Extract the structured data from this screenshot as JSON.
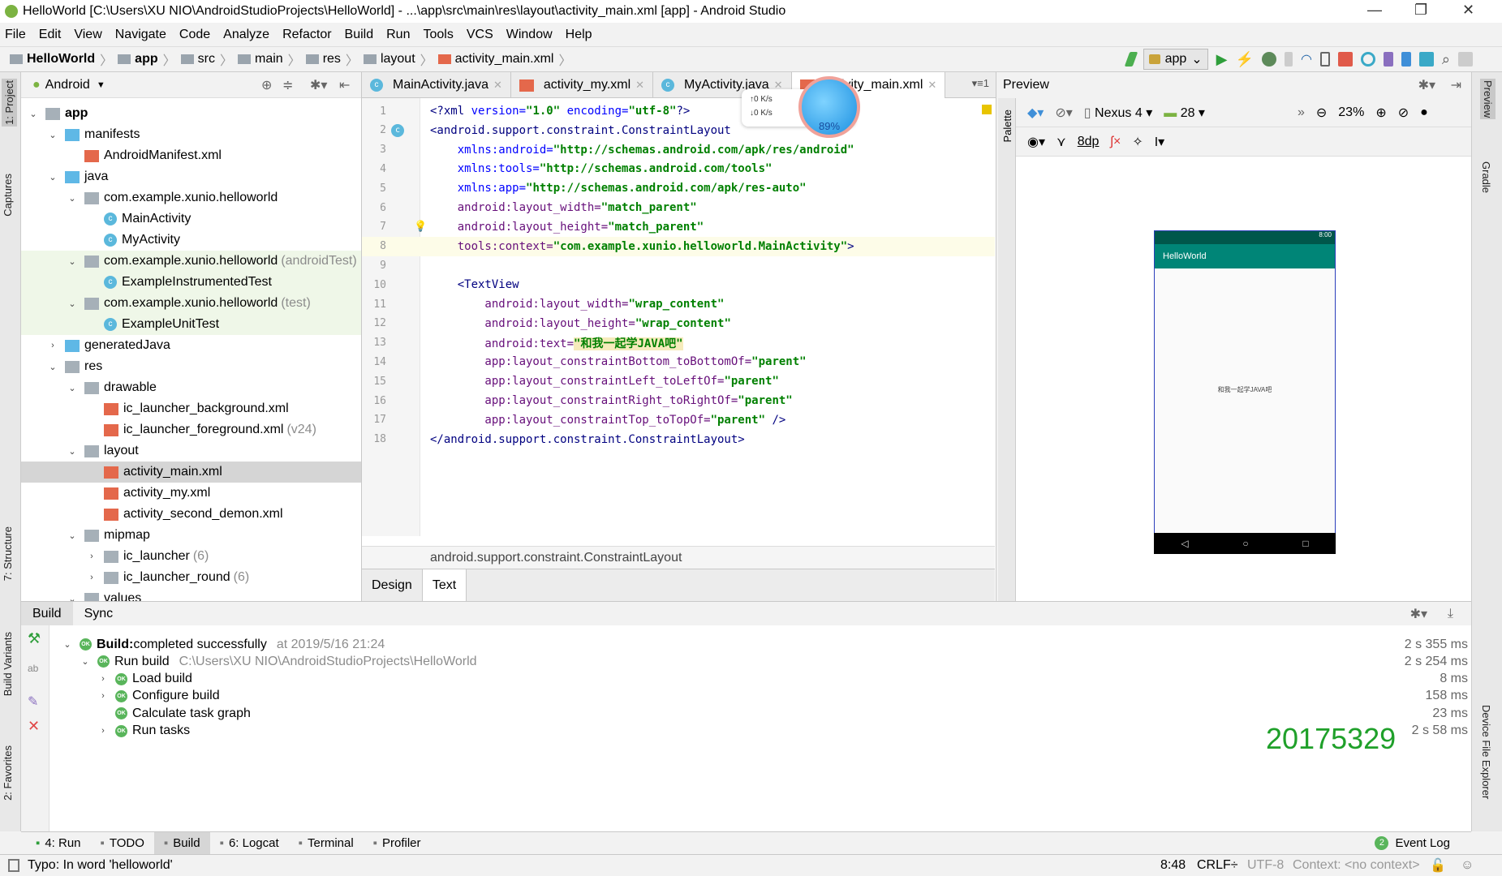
{
  "window": {
    "title": "HelloWorld [C:\\Users\\XU NIO\\AndroidStudioProjects\\HelloWorld] - ...\\app\\src\\main\\res\\layout\\activity_main.xml [app] - Android Studio",
    "minimize": "—",
    "maximize": "❐",
    "close": "✕"
  },
  "menu": [
    "File",
    "Edit",
    "View",
    "Navigate",
    "Code",
    "Analyze",
    "Refactor",
    "Build",
    "Run",
    "Tools",
    "VCS",
    "Window",
    "Help"
  ],
  "breadcrumb": [
    "HelloWorld",
    "app",
    "src",
    "main",
    "res",
    "layout",
    "activity_main.xml"
  ],
  "toolbar": {
    "run_config": "app"
  },
  "left_strip": {
    "project": "1: Project",
    "captures": "Captures",
    "structure": "7: Structure",
    "build_variants": "Build Variants",
    "favorites": "2: Favorites"
  },
  "project": {
    "view": "Android",
    "tree": [
      {
        "label": "app",
        "depth": 0,
        "arrow": "v",
        "icon": "folder",
        "bold": true
      },
      {
        "label": "manifests",
        "depth": 1,
        "arrow": "v",
        "icon": "bluef"
      },
      {
        "label": "AndroidManifest.xml",
        "depth": 2,
        "icon": "xml"
      },
      {
        "label": "java",
        "depth": 1,
        "arrow": "v",
        "icon": "bluef"
      },
      {
        "label": "com.example.xunio.helloworld",
        "depth": 2,
        "arrow": "v",
        "icon": "folder"
      },
      {
        "label": "MainActivity",
        "depth": 3,
        "icon": "cls"
      },
      {
        "label": "MyActivity",
        "depth": 3,
        "icon": "cls"
      },
      {
        "label": "com.example.xunio.helloworld",
        "suffix": "(androidTest)",
        "depth": 2,
        "arrow": "v",
        "icon": "folder",
        "green": true
      },
      {
        "label": "ExampleInstrumentedTest",
        "depth": 3,
        "icon": "cls",
        "green": true
      },
      {
        "label": "com.example.xunio.helloworld",
        "suffix": "(test)",
        "depth": 2,
        "arrow": "v",
        "icon": "folder",
        "green": true
      },
      {
        "label": "ExampleUnitTest",
        "depth": 3,
        "icon": "cls",
        "green": true
      },
      {
        "label": "generatedJava",
        "depth": 1,
        "arrow": ">",
        "icon": "bluef"
      },
      {
        "label": "res",
        "depth": 1,
        "arrow": "v",
        "icon": "folder"
      },
      {
        "label": "drawable",
        "depth": 2,
        "arrow": "v",
        "icon": "folder"
      },
      {
        "label": "ic_launcher_background.xml",
        "depth": 3,
        "icon": "xml"
      },
      {
        "label": "ic_launcher_foreground.xml",
        "suffix": "(v24)",
        "depth": 3,
        "icon": "xml"
      },
      {
        "label": "layout",
        "depth": 2,
        "arrow": "v",
        "icon": "folder"
      },
      {
        "label": "activity_main.xml",
        "depth": 3,
        "icon": "xml",
        "selected": true
      },
      {
        "label": "activity_my.xml",
        "depth": 3,
        "icon": "xml"
      },
      {
        "label": "activity_second_demon.xml",
        "depth": 3,
        "icon": "xml"
      },
      {
        "label": "mipmap",
        "depth": 2,
        "arrow": "v",
        "icon": "folder"
      },
      {
        "label": "ic_launcher",
        "suffix": "(6)",
        "depth": 3,
        "arrow": ">",
        "icon": "folder"
      },
      {
        "label": "ic_launcher_round",
        "suffix": "(6)",
        "depth": 3,
        "arrow": ">",
        "icon": "folder"
      },
      {
        "label": "values",
        "depth": 2,
        "arrow": "v",
        "icon": "folder"
      }
    ]
  },
  "editor": {
    "tabs": [
      {
        "label": "MainActivity.java",
        "icon": "cls"
      },
      {
        "label": "activity_my.xml",
        "icon": "xml"
      },
      {
        "label": "MyActivity.java",
        "icon": "cls"
      },
      {
        "label": "activity_main.xml",
        "icon": "xml",
        "active": true
      }
    ],
    "tab_overflow": "▾≡1",
    "lines": [
      [
        [
          "tag",
          "<?xml "
        ],
        [
          "ns",
          "version="
        ],
        [
          "val",
          "\"1.0\" "
        ],
        [
          "ns",
          "encoding="
        ],
        [
          "val",
          "\"utf-8\""
        ],
        [
          "tag",
          "?>"
        ]
      ],
      [
        [
          "tag",
          "<android.support.constraint.ConstraintLayout"
        ]
      ],
      [
        [
          "ns",
          "    xmlns:android="
        ],
        [
          "val",
          "\"http://schemas.android.com/apk/res/android\""
        ]
      ],
      [
        [
          "ns",
          "    xmlns:tools="
        ],
        [
          "val",
          "\"http://schemas.android.com/tools\""
        ]
      ],
      [
        [
          "ns",
          "    xmlns:app="
        ],
        [
          "val",
          "\"http://schemas.android.com/apk/res-auto\""
        ]
      ],
      [
        [
          "attr",
          "    android:layout_width="
        ],
        [
          "val",
          "\"match_parent\""
        ]
      ],
      [
        [
          "attr",
          "    android:layout_height="
        ],
        [
          "val",
          "\"match_parent\""
        ]
      ],
      [
        [
          "attr",
          "    tools:context="
        ],
        [
          "val",
          "\"com.example.xunio.helloworld.MainActivity\""
        ],
        [
          "tag",
          ">"
        ]
      ],
      [],
      [
        [
          "tag",
          "    <TextView"
        ]
      ],
      [
        [
          "attr",
          "        android:layout_width="
        ],
        [
          "val",
          "\"wrap_content\""
        ]
      ],
      [
        [
          "attr",
          "        android:layout_height="
        ],
        [
          "val",
          "\"wrap_content\""
        ]
      ],
      [
        [
          "attr",
          "        android:text="
        ],
        [
          "val",
          "\"和我一起学JAVA吧\""
        ]
      ],
      [
        [
          "attr",
          "        app:layout_constraintBottom_toBottomOf="
        ],
        [
          "val",
          "\"parent\""
        ]
      ],
      [
        [
          "attr",
          "        app:layout_constraintLeft_toLeftOf="
        ],
        [
          "val",
          "\"parent\""
        ]
      ],
      [
        [
          "attr",
          "        app:layout_constraintRight_toRightOf="
        ],
        [
          "val",
          "\"parent\""
        ]
      ],
      [
        [
          "attr",
          "        app:layout_constraintTop_toTopOf="
        ],
        [
          "val",
          "\"parent\""
        ],
        [
          "tag",
          " />"
        ]
      ],
      [
        [
          "tag",
          "</android.support.constraint.ConstraintLayout>"
        ]
      ]
    ],
    "current_line": 8,
    "status_crumb": "android.support.constraint.ConstraintLayout",
    "mode_tabs": [
      "Design",
      "Text"
    ],
    "active_mode": "Text"
  },
  "overlay": {
    "up": "↑0  K/s",
    "down": "↓0  K/s",
    "percent": "89%"
  },
  "preview": {
    "title": "Preview",
    "palette": "Palette",
    "device": "Nexus 4",
    "api": "28",
    "zoom": "23%",
    "margin": "8dp",
    "phone": {
      "status_time": "8:00",
      "app_title": "HelloWorld",
      "text": "和我一起学JAVA吧",
      "nav": [
        "◁",
        "○",
        "□"
      ]
    }
  },
  "right_strip": {
    "preview": "Preview",
    "gradle": "Gradle",
    "device_file_explorer": "Device File Explorer"
  },
  "build": {
    "tabs": [
      "Build",
      "Sync"
    ],
    "rows": [
      {
        "depth": 0,
        "arrow": "v",
        "bold": "Build:",
        "label": " completed successfully",
        "extra": "at 2019/5/16 21:24",
        "time": "2 s 355 ms"
      },
      {
        "depth": 1,
        "arrow": "v",
        "label": "Run build",
        "extra": "C:\\Users\\XU NIO\\AndroidStudioProjects\\HelloWorld",
        "time": "2 s 254 ms"
      },
      {
        "depth": 2,
        "arrow": ">",
        "label": "Load build",
        "time": "8 ms"
      },
      {
        "depth": 2,
        "arrow": ">",
        "label": "Configure build",
        "time": "158 ms"
      },
      {
        "depth": 2,
        "label": "Calculate task graph",
        "time": "23 ms"
      },
      {
        "depth": 2,
        "arrow": ">",
        "label": "Run tasks",
        "time": "2 s 58 ms"
      }
    ],
    "ok": "OK",
    "stamp": "20175329"
  },
  "tool_tabs": [
    {
      "label": "4: Run",
      "icon": "run-icon"
    },
    {
      "label": "TODO",
      "icon": "todo-icon"
    },
    {
      "label": "Build",
      "icon": "build-icon",
      "active": true
    },
    {
      "label": "6: Logcat",
      "icon": "logcat-icon"
    },
    {
      "label": "Terminal",
      "icon": "terminal-icon"
    },
    {
      "label": "Profiler",
      "icon": "profiler-icon"
    }
  ],
  "event_log": {
    "count": "2",
    "label": "Event Log"
  },
  "status": {
    "message": "Typo: In word 'helloworld'",
    "position": "8:48",
    "line_sep": "CRLF÷",
    "encoding": "UTF-8",
    "context": "Context: <no context>"
  },
  "colors": {
    "accent_green": "#1fa02a",
    "app_bar": "#008577",
    "status_bar": "#00574b"
  }
}
